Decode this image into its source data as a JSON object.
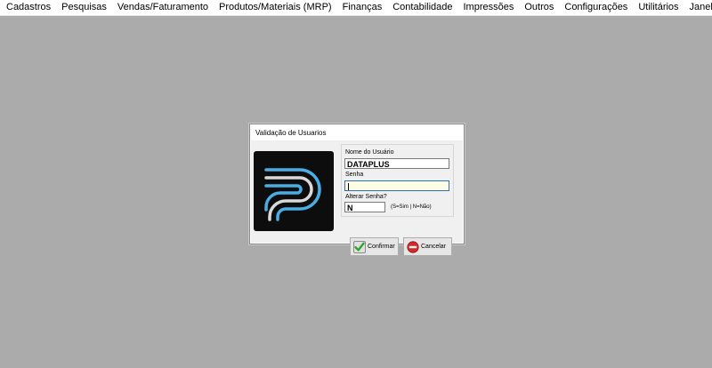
{
  "menubar": {
    "items": [
      "Cadastros",
      "Pesquisas",
      "Vendas/Faturamento",
      "Produtos/Materiais (MRP)",
      "Finanças",
      "Contabilidade",
      "Impressões",
      "Outros",
      "Configurações",
      "Utilitários",
      "Janelas"
    ]
  },
  "dialog": {
    "title": "Validação de Usuarios",
    "username_label": "Nome do Usuário",
    "username_value": "DATAPLUS",
    "password_label": "Senha",
    "password_value": "",
    "change_password_label": "Alterar Senha?",
    "change_password_value": "N",
    "change_password_hint": "(S=Sim  |  N=Não)",
    "confirm_label": "Confirmar",
    "cancel_label": "Cancelar"
  },
  "colors": {
    "desktop_background": "#ababab",
    "logo_background": "#0d0d0d",
    "logo_accent": "#4aaee6",
    "logo_stroke": "#d9d9d9",
    "focus_border": "#2f6fb4"
  },
  "icons": {
    "logo": "dataplus-logo",
    "confirm": "check-icon",
    "cancel": "no-entry-icon"
  }
}
